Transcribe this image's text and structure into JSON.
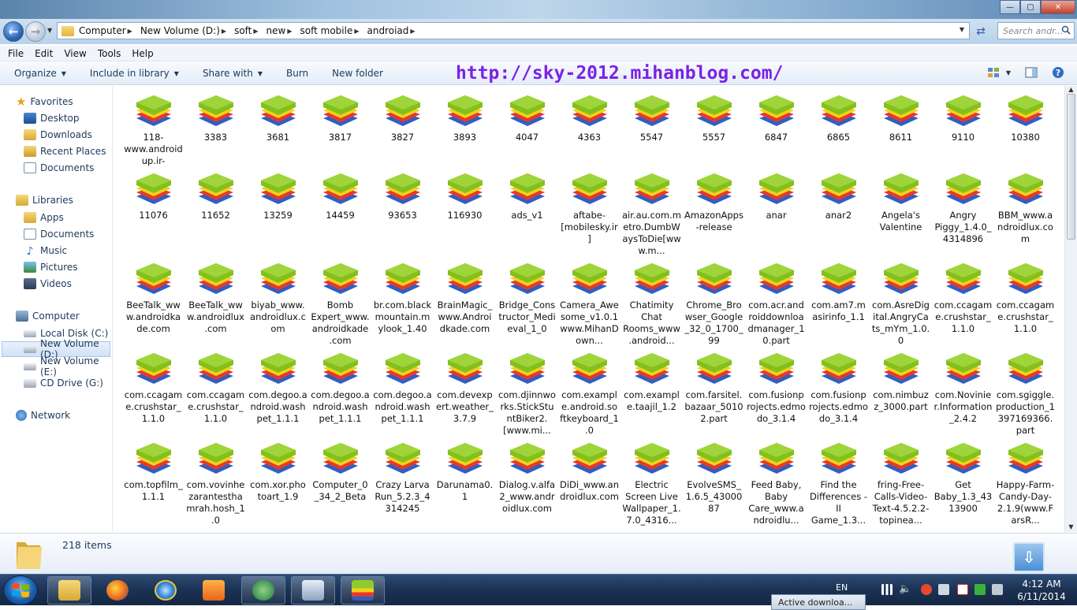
{
  "window": {
    "controls": {
      "minimize": "—",
      "maximize": "▢",
      "close": "✕"
    }
  },
  "address": {
    "crumbs": [
      "Computer",
      "New Volume (D:)",
      "soft",
      "new",
      "soft mobile",
      "androiad"
    ],
    "search_placeholder": "Search andr..."
  },
  "menu": [
    "File",
    "Edit",
    "View",
    "Tools",
    "Help"
  ],
  "toolbar": {
    "organize": "Organize",
    "include": "Include in library",
    "share": "Share with",
    "burn": "Burn",
    "new_folder": "New folder"
  },
  "watermark": "http://sky-2012.mihanblog.com/",
  "sidebar": {
    "favorites": {
      "label": "Favorites",
      "items": [
        "Desktop",
        "Downloads",
        "Recent Places",
        "Documents"
      ]
    },
    "libraries": {
      "label": "Libraries",
      "items": [
        "Apps",
        "Documents",
        "Music",
        "Pictures",
        "Videos"
      ]
    },
    "computer": {
      "label": "Computer",
      "items": [
        "Local Disk (C:)",
        "New Volume (D:)",
        "New Volume (E:)",
        "CD Drive (G:)"
      ]
    },
    "network": {
      "label": "Network"
    }
  },
  "files": [
    "118-www.androidup.ir-",
    "3383",
    "3681",
    "3817",
    "3827",
    "3893",
    "4047",
    "4363",
    "5547",
    "5557",
    "6847",
    "6865",
    "8611",
    "9110",
    "10380",
    "11076",
    "11652",
    "13259",
    "14459",
    "93653",
    "116930",
    "ads_v1",
    "aftabe-[mobilesky.ir]",
    "air.au.com.metro.DumbWaysToDie[www.m...",
    "AmazonApps-release",
    "anar",
    "anar2",
    "Angela's Valentine",
    "Angry Piggy_1.4.0_4314896",
    "BBM_www.androidlux.com",
    "BeeTalk_www.androidkade.com",
    "BeeTalk_www.androidlux.com",
    "biyab_www.androidlux.com",
    "Bomb Expert_www.androidkade.com",
    "br.com.blackmountain.mylook_1.40",
    "BrainMagic_www.Androidkade.com",
    "Bridge_Constructor_Medieval_1_0",
    "Camera_Awesome_v1.0.1www.MihanDown...",
    "Chatimity Chat Rooms_www.android...",
    "Chrome_Browser_Google_32_0_1700_99",
    "com.acr.androiddownloadmanager_10.part",
    "com.am7.masirinfo_1.1",
    "com.AsreDigital.AngryCats_mYm_1.0.0",
    "com.ccagame.crushstar_1.1.0",
    "com.ccagame.crushstar_1.1.0",
    "com.ccagame.crushstar_1.1.0",
    "com.ccagame.crushstar_1.1.0",
    "com.degoo.android.washpet_1.1.1",
    "com.degoo.android.washpet_1.1.1",
    "com.degoo.android.washpet_1.1.1",
    "com.devexpert.weather_3.7.9",
    "com.djinnworks.StickStuntBiker2.[www.mi...",
    "com.example.android.softkeyboard_1.0",
    "com.example.taajil_1.2",
    "com.farsitel.bazaar_50102.part",
    "com.fusionprojects.edmodo_3.1.4",
    "com.fusionprojects.edmodo_3.1.4",
    "com.nimbuzz_3000.part",
    "com.Novinier.Information_2.4.2",
    "com.sgiggle.production_1397169366.part",
    "com.topfilm_1.1.1",
    "com.vovinhezarantesthamrah.hosh_1.0",
    "com.xor.photoart_1.9",
    "Computer_0_34_2_Beta",
    "Crazy Larva Run_5.2.3_4314245",
    "Darunama0.1",
    "Dialog.v.alfa2_www.androidlux.com",
    "DiDi_www.androidlux.com",
    "Electric Screen Live Wallpaper_1.7.0_4316...",
    "EvolveSMS_1.6.5_4300087",
    "Feed Baby, Baby Care_www.androidlu...",
    "Find the Differences - II Game_1.3...",
    "fring-Free-Calls-Video-Text-4.5.2.2-topinea...",
    "Get Baby_1.3_4313900",
    "Happy-Farm-Candy-Day-2.1.9(www.FarsR..."
  ],
  "status": {
    "count": "218 items"
  },
  "taskbar": {
    "lang": "EN",
    "time": "4:12 AM",
    "date": "6/11/2014",
    "notify": "Active downloa..."
  },
  "colors": {
    "accent": "#7b22e6",
    "nav_text": "#1e395b",
    "titlebar": "#8db2d4"
  },
  "icons": {
    "app_icon": "layered-stack-icon",
    "folder": "folder-icon"
  }
}
